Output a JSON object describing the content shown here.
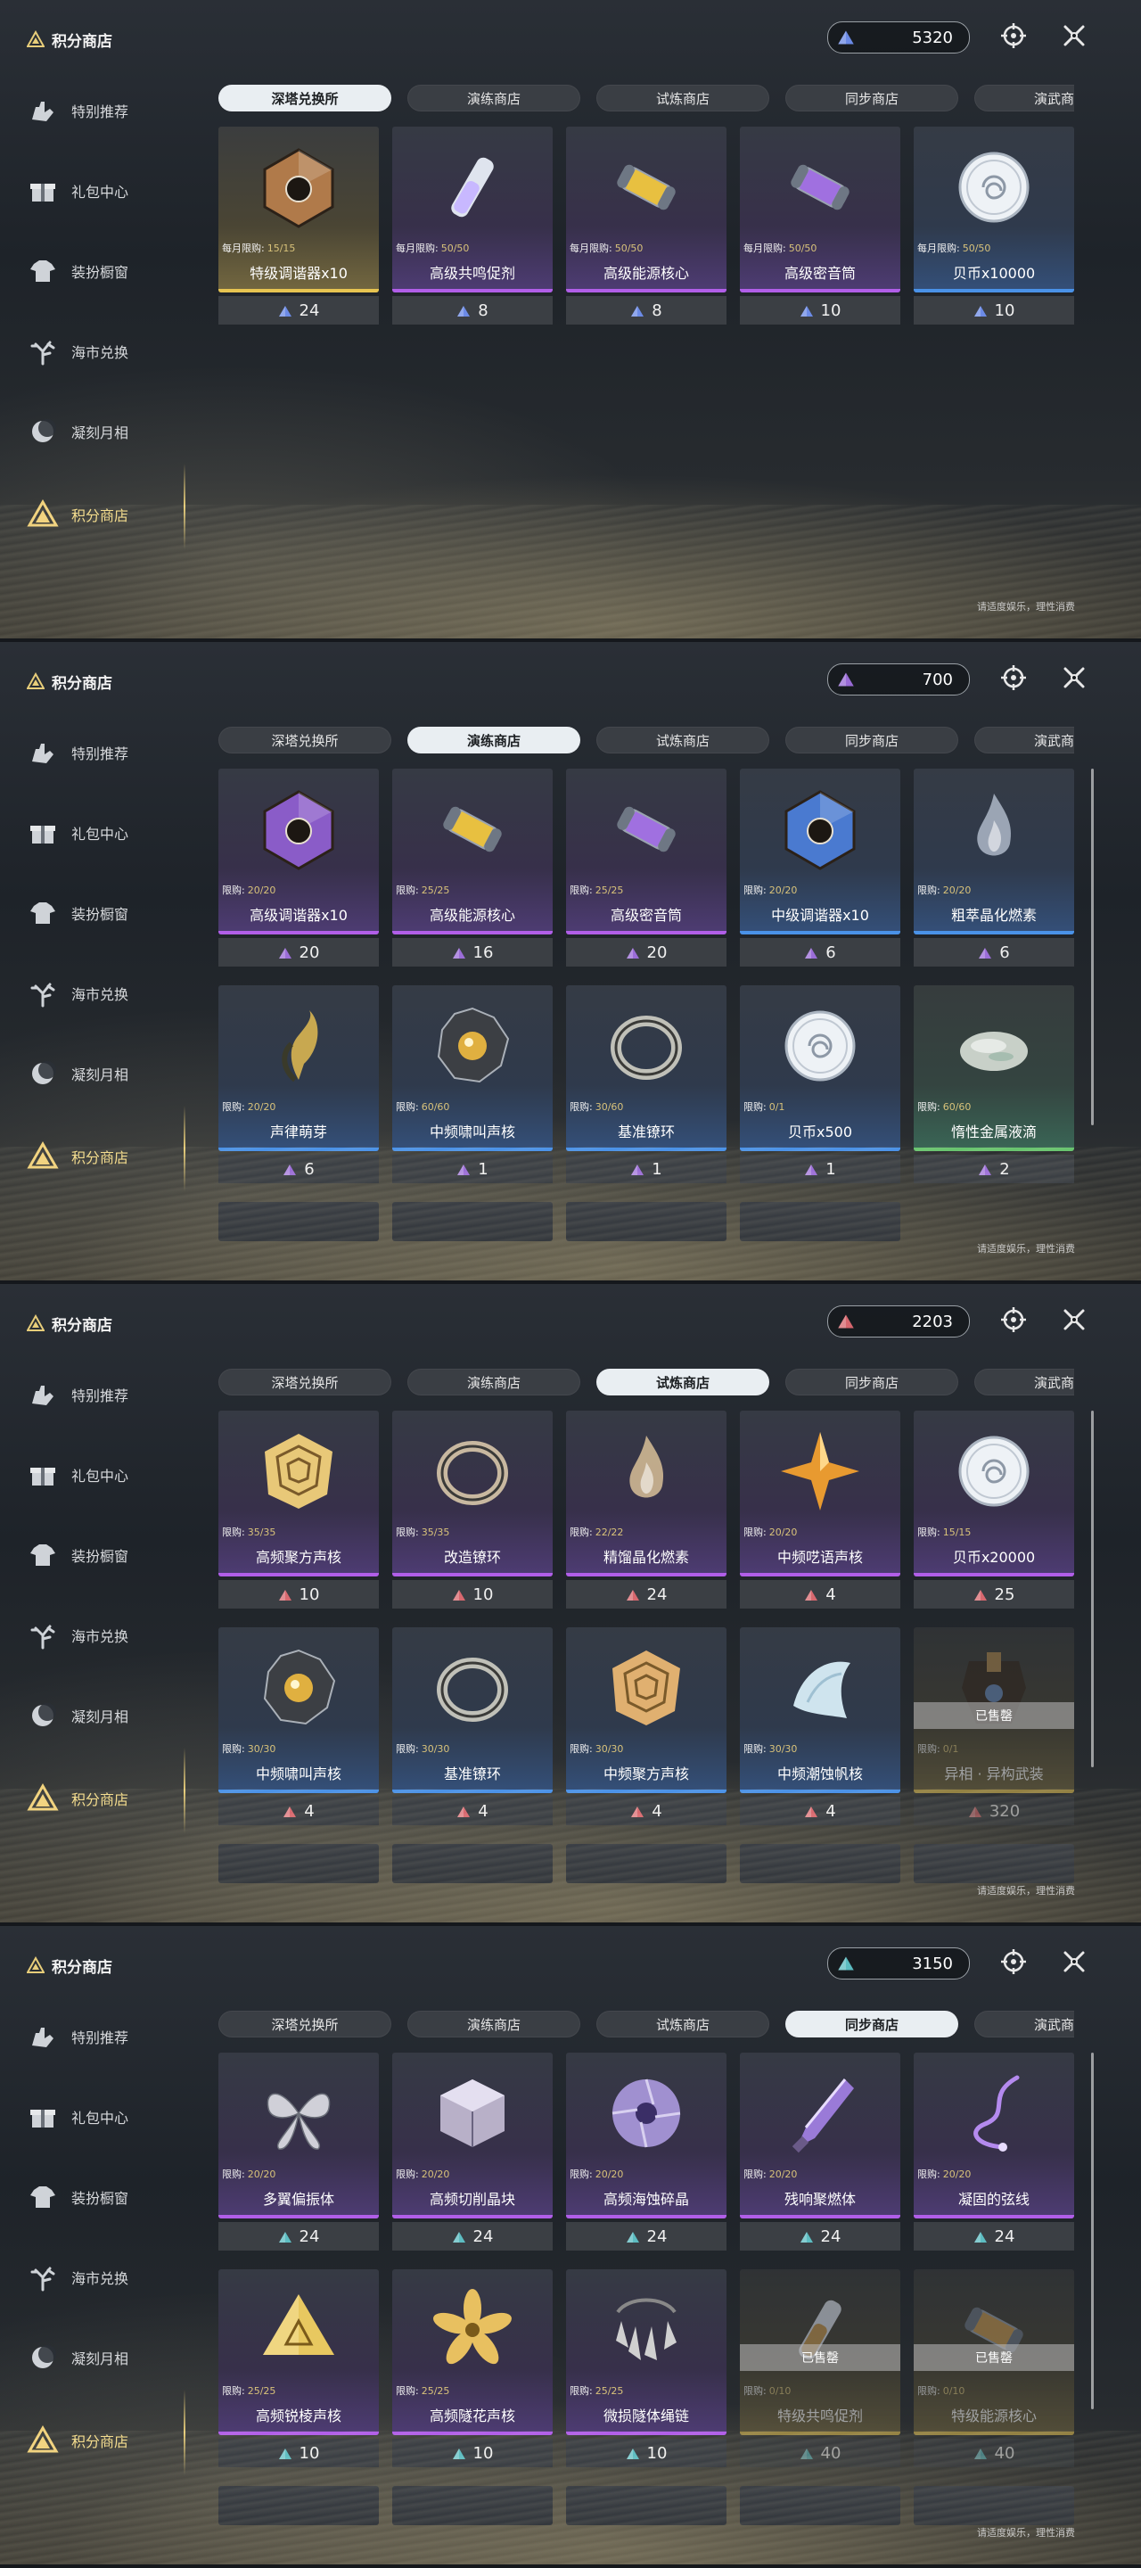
{
  "colors": {
    "tier1": "#6f8ff0",
    "tier2": "#a070e0",
    "tier3": "#e06a72",
    "tier4": "#5fc4c9",
    "accent_gold": "#e7cd7a"
  },
  "header": {
    "title": "积分商店"
  },
  "sidebar": {
    "items": [
      {
        "label": "特别推荐",
        "icon": "hand-icon"
      },
      {
        "label": "礼包中心",
        "icon": "gift-icon"
      },
      {
        "label": "装扮橱窗",
        "icon": "shirt-icon"
      },
      {
        "label": "海市兑换",
        "icon": "coral-icon"
      },
      {
        "label": "凝刻月相",
        "icon": "moon-icon"
      },
      {
        "label": "积分商店",
        "icon": "triangle-icon"
      }
    ],
    "active_index": 5
  },
  "tabs": [
    "深塔兑换所",
    "演练商店",
    "试炼商店",
    "同步商店",
    "演武商店"
  ],
  "limit_prefix_monthly": "每月限购:",
  "limit_prefix": "限购:",
  "sold_out_label": "已售罄",
  "footer_note": "请适度娱乐，理性消费",
  "panels": [
    {
      "active_tab": 0,
      "currency": "5320",
      "currency_tier": "tier1",
      "scrollbar": false,
      "items": [
        {
          "name": "特级调谐器x10",
          "limit": "15/15",
          "monthly": true,
          "price": "24",
          "quality": "gold",
          "art": "tuner-icon",
          "tint": "#b07a4a"
        },
        {
          "name": "高级共鸣促剂",
          "limit": "50/50",
          "monthly": true,
          "price": "8",
          "quality": "purple",
          "art": "vial-icon",
          "tint": "#c8b8ff"
        },
        {
          "name": "高级能源核心",
          "limit": "50/50",
          "monthly": true,
          "price": "8",
          "quality": "purple",
          "art": "capsule-icon",
          "tint": "#e8c040"
        },
        {
          "name": "高级密音筒",
          "limit": "50/50",
          "monthly": true,
          "price": "10",
          "quality": "purple",
          "art": "capsule-icon",
          "tint": "#a070e0"
        },
        {
          "name": "贝币x10000",
          "limit": "50/50",
          "monthly": true,
          "price": "10",
          "quality": "blue",
          "art": "shell-coin-icon",
          "tint": "#dfe6ee"
        }
      ]
    },
    {
      "active_tab": 1,
      "currency": "700",
      "currency_tier": "tier2",
      "scrollbar": true,
      "items": [
        {
          "name": "高级调谐器x10",
          "limit": "20/20",
          "price": "20",
          "quality": "purple",
          "art": "tuner-icon",
          "tint": "#8a5cc8"
        },
        {
          "name": "高级能源核心",
          "limit": "25/25",
          "price": "16",
          "quality": "purple",
          "art": "capsule-icon",
          "tint": "#e8c040"
        },
        {
          "name": "高级密音筒",
          "limit": "25/25",
          "price": "20",
          "quality": "purple",
          "art": "capsule-icon",
          "tint": "#a070e0"
        },
        {
          "name": "中级调谐器x10",
          "limit": "20/20",
          "price": "6",
          "quality": "blue",
          "art": "tuner-icon",
          "tint": "#4a7ad0"
        },
        {
          "name": "粗萃晶化燃素",
          "limit": "20/20",
          "price": "6",
          "quality": "blue",
          "art": "flame-icon",
          "tint": "#aeb8c8"
        },
        {
          "name": "声律萌芽",
          "limit": "20/20",
          "price": "6",
          "quality": "blue",
          "art": "sprout-icon",
          "tint": "#c8a850"
        },
        {
          "name": "中频啸叫声核",
          "limit": "60/60",
          "price": "1",
          "quality": "blue",
          "art": "core-icon",
          "tint": "#e0b040"
        },
        {
          "name": "基准镣环",
          "limit": "30/60",
          "price": "1",
          "quality": "blue",
          "art": "ring-icon",
          "tint": "#c0c0b8"
        },
        {
          "name": "贝币x500",
          "limit": "0/1",
          "price": "1",
          "quality": "blue",
          "art": "shell-coin-icon",
          "tint": "#dfe6ee"
        },
        {
          "name": "惰性金属液滴",
          "limit": "60/60",
          "price": "2",
          "quality": "green",
          "art": "droplet-icon",
          "tint": "#c8d0c8"
        }
      ]
    },
    {
      "active_tab": 2,
      "currency": "2203",
      "currency_tier": "tier3",
      "scrollbar": true,
      "items": [
        {
          "name": "高频聚方声核",
          "limit": "35/35",
          "price": "10",
          "quality": "purple",
          "art": "cube-icon",
          "tint": "#e8c878"
        },
        {
          "name": "改造镣环",
          "limit": "35/35",
          "price": "10",
          "quality": "purple",
          "art": "ring-icon",
          "tint": "#c8b8a0"
        },
        {
          "name": "精馏晶化燃素",
          "limit": "22/22",
          "price": "24",
          "quality": "purple",
          "art": "flame-icon",
          "tint": "#d8c098"
        },
        {
          "name": "中频呓语声核",
          "limit": "20/20",
          "price": "4",
          "quality": "purple",
          "art": "star-icon",
          "tint": "#e89a30"
        },
        {
          "name": "贝币x20000",
          "limit": "15/15",
          "price": "25",
          "quality": "purple",
          "art": "shell-coin-icon",
          "tint": "#dfe6ee"
        },
        {
          "name": "中频啸叫声核",
          "limit": "30/30",
          "price": "4",
          "quality": "blue",
          "art": "core-icon",
          "tint": "#e0b040"
        },
        {
          "name": "基准镣环",
          "limit": "30/30",
          "price": "4",
          "quality": "blue",
          "art": "ring-icon",
          "tint": "#c0c0b8"
        },
        {
          "name": "中频聚方声核",
          "limit": "30/30",
          "price": "4",
          "quality": "blue",
          "art": "cube-icon",
          "tint": "#e0b070"
        },
        {
          "name": "中频潮蚀帆核",
          "limit": "30/30",
          "price": "4",
          "quality": "blue",
          "art": "sail-icon",
          "tint": "#cfe4ee"
        },
        {
          "name": "异相 · 异构武装",
          "limit": "0/1",
          "price": "320",
          "quality": "gold",
          "art": "armor-icon",
          "tint": "#b08a50",
          "sold_out": true
        }
      ]
    },
    {
      "active_tab": 3,
      "currency": "3150",
      "currency_tier": "tier4",
      "scrollbar": true,
      "items": [
        {
          "name": "多翼偏振体",
          "limit": "20/20",
          "price": "24",
          "quality": "purple",
          "art": "wings-icon",
          "tint": "#d0d0d8"
        },
        {
          "name": "高频切削晶块",
          "limit": "20/20",
          "price": "24",
          "quality": "purple",
          "art": "block-icon",
          "tint": "#b8b0c8"
        },
        {
          "name": "高频海蚀碎晶",
          "limit": "20/20",
          "price": "24",
          "quality": "purple",
          "art": "disc-icon",
          "tint": "#a090d0"
        },
        {
          "name": "残响聚燃体",
          "limit": "20/20",
          "price": "24",
          "quality": "purple",
          "art": "blade-icon",
          "tint": "#9a7ad8"
        },
        {
          "name": "凝固的弦线",
          "limit": "20/20",
          "price": "24",
          "quality": "purple",
          "art": "string-icon",
          "tint": "#b48aee"
        },
        {
          "name": "高频锐棱声核",
          "limit": "25/25",
          "price": "10",
          "quality": "purple",
          "art": "pyramid-icon",
          "tint": "#e8c860"
        },
        {
          "name": "高频隧花声核",
          "limit": "25/25",
          "price": "10",
          "quality": "purple",
          "art": "flower-icon",
          "tint": "#e8c060"
        },
        {
          "name": "微损隧体绳链",
          "limit": "25/25",
          "price": "10",
          "quality": "purple",
          "art": "chain-icon",
          "tint": "#d0d0d0"
        },
        {
          "name": "特级共鸣促剂",
          "limit": "0/10",
          "price": "40",
          "quality": "gold",
          "art": "vial-icon",
          "tint": "#c89a50",
          "sold_out": true
        },
        {
          "name": "特级能源核心",
          "limit": "0/10",
          "price": "40",
          "quality": "gold",
          "art": "capsule-icon",
          "tint": "#c89a50",
          "sold_out": true
        }
      ]
    }
  ]
}
